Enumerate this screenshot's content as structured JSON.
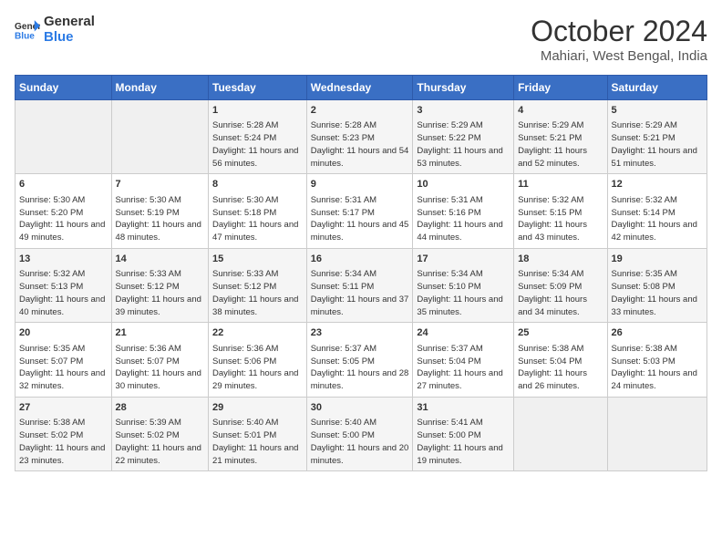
{
  "logo": {
    "line1": "General",
    "line2": "Blue"
  },
  "title": "October 2024",
  "location": "Mahiari, West Bengal, India",
  "header_days": [
    "Sunday",
    "Monday",
    "Tuesday",
    "Wednesday",
    "Thursday",
    "Friday",
    "Saturday"
  ],
  "weeks": [
    [
      {
        "day": "",
        "content": ""
      },
      {
        "day": "",
        "content": ""
      },
      {
        "day": "1",
        "content": "Sunrise: 5:28 AM\nSunset: 5:24 PM\nDaylight: 11 hours and 56 minutes."
      },
      {
        "day": "2",
        "content": "Sunrise: 5:28 AM\nSunset: 5:23 PM\nDaylight: 11 hours and 54 minutes."
      },
      {
        "day": "3",
        "content": "Sunrise: 5:29 AM\nSunset: 5:22 PM\nDaylight: 11 hours and 53 minutes."
      },
      {
        "day": "4",
        "content": "Sunrise: 5:29 AM\nSunset: 5:21 PM\nDaylight: 11 hours and 52 minutes."
      },
      {
        "day": "5",
        "content": "Sunrise: 5:29 AM\nSunset: 5:21 PM\nDaylight: 11 hours and 51 minutes."
      }
    ],
    [
      {
        "day": "6",
        "content": "Sunrise: 5:30 AM\nSunset: 5:20 PM\nDaylight: 11 hours and 49 minutes."
      },
      {
        "day": "7",
        "content": "Sunrise: 5:30 AM\nSunset: 5:19 PM\nDaylight: 11 hours and 48 minutes."
      },
      {
        "day": "8",
        "content": "Sunrise: 5:30 AM\nSunset: 5:18 PM\nDaylight: 11 hours and 47 minutes."
      },
      {
        "day": "9",
        "content": "Sunrise: 5:31 AM\nSunset: 5:17 PM\nDaylight: 11 hours and 45 minutes."
      },
      {
        "day": "10",
        "content": "Sunrise: 5:31 AM\nSunset: 5:16 PM\nDaylight: 11 hours and 44 minutes."
      },
      {
        "day": "11",
        "content": "Sunrise: 5:32 AM\nSunset: 5:15 PM\nDaylight: 11 hours and 43 minutes."
      },
      {
        "day": "12",
        "content": "Sunrise: 5:32 AM\nSunset: 5:14 PM\nDaylight: 11 hours and 42 minutes."
      }
    ],
    [
      {
        "day": "13",
        "content": "Sunrise: 5:32 AM\nSunset: 5:13 PM\nDaylight: 11 hours and 40 minutes."
      },
      {
        "day": "14",
        "content": "Sunrise: 5:33 AM\nSunset: 5:12 PM\nDaylight: 11 hours and 39 minutes."
      },
      {
        "day": "15",
        "content": "Sunrise: 5:33 AM\nSunset: 5:12 PM\nDaylight: 11 hours and 38 minutes."
      },
      {
        "day": "16",
        "content": "Sunrise: 5:34 AM\nSunset: 5:11 PM\nDaylight: 11 hours and 37 minutes."
      },
      {
        "day": "17",
        "content": "Sunrise: 5:34 AM\nSunset: 5:10 PM\nDaylight: 11 hours and 35 minutes."
      },
      {
        "day": "18",
        "content": "Sunrise: 5:34 AM\nSunset: 5:09 PM\nDaylight: 11 hours and 34 minutes."
      },
      {
        "day": "19",
        "content": "Sunrise: 5:35 AM\nSunset: 5:08 PM\nDaylight: 11 hours and 33 minutes."
      }
    ],
    [
      {
        "day": "20",
        "content": "Sunrise: 5:35 AM\nSunset: 5:07 PM\nDaylight: 11 hours and 32 minutes."
      },
      {
        "day": "21",
        "content": "Sunrise: 5:36 AM\nSunset: 5:07 PM\nDaylight: 11 hours and 30 minutes."
      },
      {
        "day": "22",
        "content": "Sunrise: 5:36 AM\nSunset: 5:06 PM\nDaylight: 11 hours and 29 minutes."
      },
      {
        "day": "23",
        "content": "Sunrise: 5:37 AM\nSunset: 5:05 PM\nDaylight: 11 hours and 28 minutes."
      },
      {
        "day": "24",
        "content": "Sunrise: 5:37 AM\nSunset: 5:04 PM\nDaylight: 11 hours and 27 minutes."
      },
      {
        "day": "25",
        "content": "Sunrise: 5:38 AM\nSunset: 5:04 PM\nDaylight: 11 hours and 26 minutes."
      },
      {
        "day": "26",
        "content": "Sunrise: 5:38 AM\nSunset: 5:03 PM\nDaylight: 11 hours and 24 minutes."
      }
    ],
    [
      {
        "day": "27",
        "content": "Sunrise: 5:38 AM\nSunset: 5:02 PM\nDaylight: 11 hours and 23 minutes."
      },
      {
        "day": "28",
        "content": "Sunrise: 5:39 AM\nSunset: 5:02 PM\nDaylight: 11 hours and 22 minutes."
      },
      {
        "day": "29",
        "content": "Sunrise: 5:40 AM\nSunset: 5:01 PM\nDaylight: 11 hours and 21 minutes."
      },
      {
        "day": "30",
        "content": "Sunrise: 5:40 AM\nSunset: 5:00 PM\nDaylight: 11 hours and 20 minutes."
      },
      {
        "day": "31",
        "content": "Sunrise: 5:41 AM\nSunset: 5:00 PM\nDaylight: 11 hours and 19 minutes."
      },
      {
        "day": "",
        "content": ""
      },
      {
        "day": "",
        "content": ""
      }
    ]
  ]
}
